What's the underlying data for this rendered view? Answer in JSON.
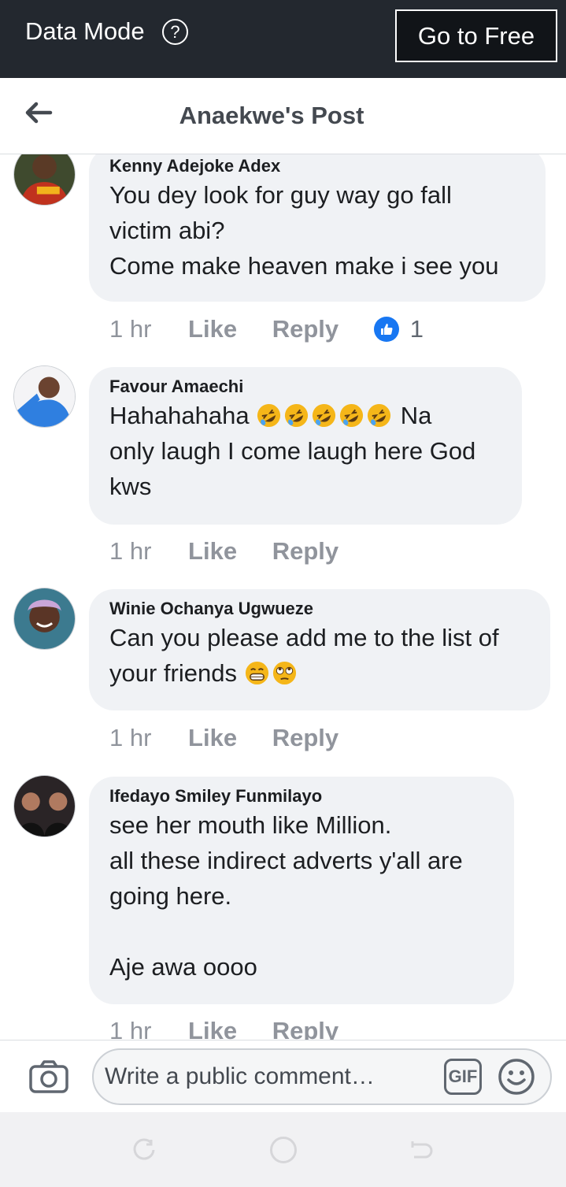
{
  "status_bar": {
    "data_mode_label": "Data Mode",
    "help_glyph": "?",
    "go_free_label": "Go to Free"
  },
  "header": {
    "title": "Anaekwe's Post",
    "back_icon": "arrow-left-icon"
  },
  "comments": [
    {
      "author": "Kenny Adejoke Adex",
      "text": "You dey look for guy way go fall\nvictim abi?\nCome make heaven make i see you",
      "time": "1 hr",
      "like_label": "Like",
      "reply_label": "Reply",
      "reaction_count": "1"
    },
    {
      "author": "Favour Amaechi",
      "text_before": "Hahahahaha ",
      "text_after": " Na\nonly laugh I come laugh here God\nkws",
      "emojis": [
        "rolling-on-floor-laughing-emoji",
        "rolling-on-floor-laughing-emoji",
        "rolling-on-floor-laughing-emoji",
        "rolling-on-floor-laughing-emoji",
        "rolling-on-floor-laughing-emoji"
      ],
      "time": "1 hr",
      "like_label": "Like",
      "reply_label": "Reply"
    },
    {
      "author": "Winie Ochanya Ugwueze",
      "text_before": "Can you please add me to the list of\nyour friends ",
      "emojis": [
        "beaming-grin-emoji",
        "eye-roll-emoji"
      ],
      "time": "1 hr",
      "like_label": "Like",
      "reply_label": "Reply"
    },
    {
      "author": "Ifedayo Smiley Funmilayo",
      "text": "see her mouth like Million.\nall these indirect adverts y'all are\ngoing here.\n\nAje awa oooo",
      "time": "1 hr",
      "like_label": "Like",
      "reply_label": "Reply"
    }
  ],
  "composer": {
    "placeholder": "Write a public comment…",
    "gif_label": "GIF",
    "camera_icon": "camera-icon",
    "emoji_icon": "smiley-icon"
  },
  "colors": {
    "top_bar": "#23282f",
    "bubble": "#f0f2f5",
    "meta_text": "#90949c",
    "like_blue": "#1877f2"
  }
}
